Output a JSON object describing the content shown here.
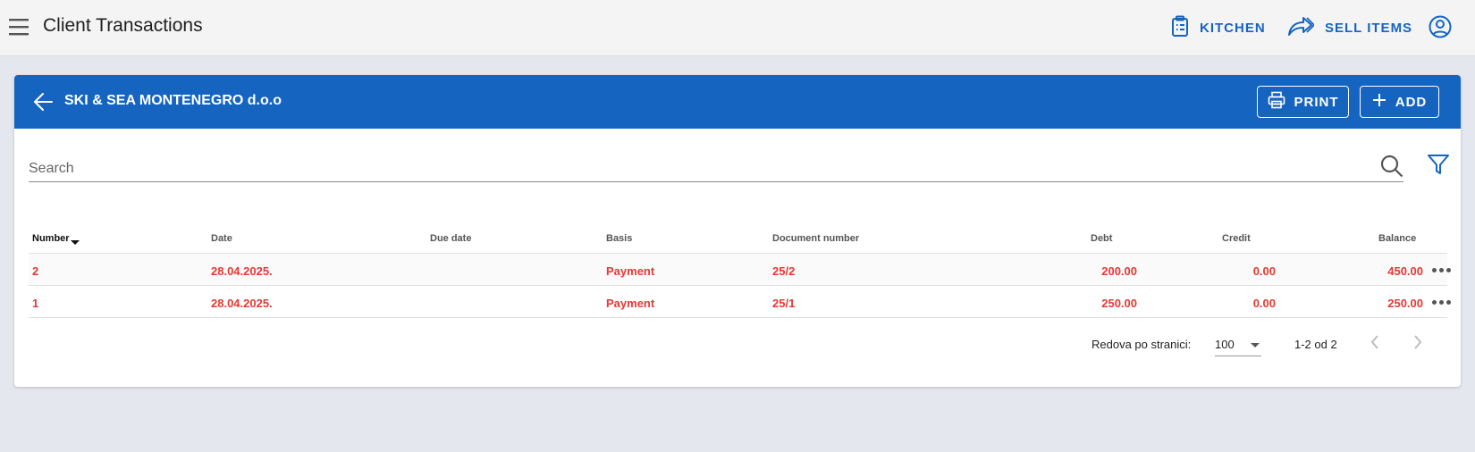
{
  "appbar": {
    "title": "Client Transactions",
    "kitchen_label": "KITCHEN",
    "sell_items_label": "SELL ITEMS"
  },
  "card": {
    "client_name": "SKI & SEA MONTENEGRO d.o.o",
    "print_label": "PRINT",
    "add_label": "ADD"
  },
  "search": {
    "placeholder": "Search"
  },
  "table": {
    "columns": [
      "Number",
      "Date",
      "Due date",
      "Basis",
      "Document number",
      "Debt",
      "Credit",
      "Balance"
    ],
    "rows": [
      {
        "number": "2",
        "date": "28.04.2025.",
        "due_date": "",
        "basis": "Payment",
        "document_number": "25/2",
        "debt": "200.00",
        "credit": "0.00",
        "balance": "450.00"
      },
      {
        "number": "1",
        "date": "28.04.2025.",
        "due_date": "",
        "basis": "Payment",
        "document_number": "25/1",
        "debt": "250.00",
        "credit": "0.00",
        "balance": "250.00"
      }
    ]
  },
  "pagination": {
    "rows_per_page_label": "Redova po stranici:",
    "rows_per_page_value": "100",
    "range": "1-2 od 2"
  },
  "colors": {
    "primary": "#1565c0",
    "row_text": "#e53935",
    "background": "#e4e7ee"
  }
}
